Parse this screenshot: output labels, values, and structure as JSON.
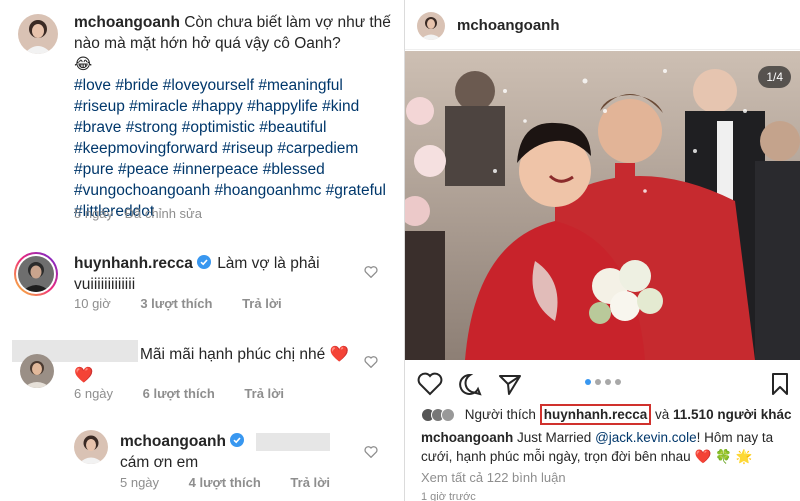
{
  "left": {
    "caption": {
      "username": "mchoangoanh",
      "text": "Còn chưa biết làm vợ như thế nào mà mặt hớn hở quá vậy cô Oanh?",
      "emoji": "😂",
      "hashtags": "#love #bride #loveyourself #meaningful #riseup #miracle #happy #happylife #kind #brave #strong #optimistic #beautiful #keepmovingforward #riseup #carpediem #pure #peace #innerpeace #blessed #vungochoangoanh #hoangoanhmc #grateful #littlereddot",
      "time": "5 ngày",
      "edited": "· Đã chỉnh sửa"
    },
    "comments": [
      {
        "username": "huynhanh.recca",
        "text": "Làm vợ là phải vuiiiiiiiiiiiii",
        "time": "10 giờ",
        "likes": "3 lượt thích",
        "reply": "Trả lời"
      },
      {
        "username": "",
        "text": "Mãi mãi hạnh phúc chị nhé",
        "hearts": "❤️❤️",
        "time": "6 ngày",
        "likes": "6 lượt thích",
        "reply": "Trả lời"
      },
      {
        "username": "mchoangoanh",
        "text": "cám ơn em",
        "time": "5 ngày",
        "likes": "4 lượt thích",
        "reply": "Trả lời"
      }
    ]
  },
  "right": {
    "username": "mchoangoanh",
    "counter": "1/4",
    "likes": {
      "prefix": "Người thích",
      "highlight_user": "huynhanh.recca",
      "middle": "và",
      "count": "11.510 người khác"
    },
    "caption": {
      "username": "mchoangoanh",
      "text1": "Just Married",
      "mention": "@jack.kevin.cole",
      "text2": "! Hôm nay ta cưới, hạnh phúc mỗi ngày, trọn đời bên nhau",
      "emojis": "❤️ 🍀 🌟"
    },
    "view_comments": "Xem tất cả 122 bình luận",
    "time": "1 giờ trước"
  },
  "icons": {
    "heart": "heart-icon",
    "comment": "comment-icon",
    "share": "share-icon",
    "bookmark": "bookmark-icon",
    "verified": "verified-badge-icon"
  },
  "colors": {
    "link": "#00376b",
    "meta": "#8e8e8e",
    "verified": "#3897f0",
    "highlight_box": "#d0312d",
    "ao_dai_red": "#c62a2f"
  }
}
